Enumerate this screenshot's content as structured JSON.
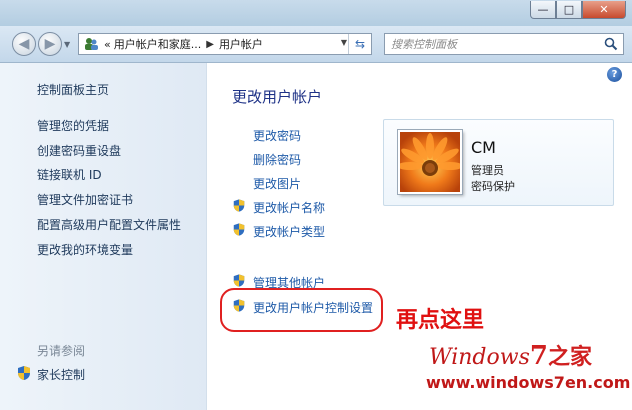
{
  "window": {
    "minimize": "—",
    "maximize": "□",
    "close": "✕"
  },
  "address": {
    "prefix": "«",
    "crumbs": [
      "用户帐户和家庭...",
      "用户帐户"
    ],
    "search_placeholder": "搜索控制面板"
  },
  "sidebar": {
    "home": "控制面板主页",
    "items": [
      "管理您的凭据",
      "创建密码重设盘",
      "链接联机 ID",
      "管理文件加密证书",
      "配置高级用户配置文件属性",
      "更改我的环境变量"
    ],
    "see_also": "另请参阅",
    "parental": "家长控制"
  },
  "main": {
    "title": "更改用户帐户",
    "links": [
      "更改密码",
      "删除密码",
      "更改图片",
      "更改帐户名称",
      "更改帐户类型"
    ],
    "other_links": [
      "管理其他帐户",
      "更改用户帐户控制设置"
    ],
    "help": "?"
  },
  "user": {
    "name": "CM",
    "role": "管理员",
    "status": "密码保护"
  },
  "annotation": {
    "text": "再点这里"
  },
  "watermark": {
    "brand_a": "Windows",
    "brand_num": "7",
    "brand_b": "之家",
    "url": "www.windows7en.com"
  },
  "colors": {
    "accent_link": "#1e5aa8",
    "title": "#1e3287",
    "annotation": "#e01010"
  }
}
